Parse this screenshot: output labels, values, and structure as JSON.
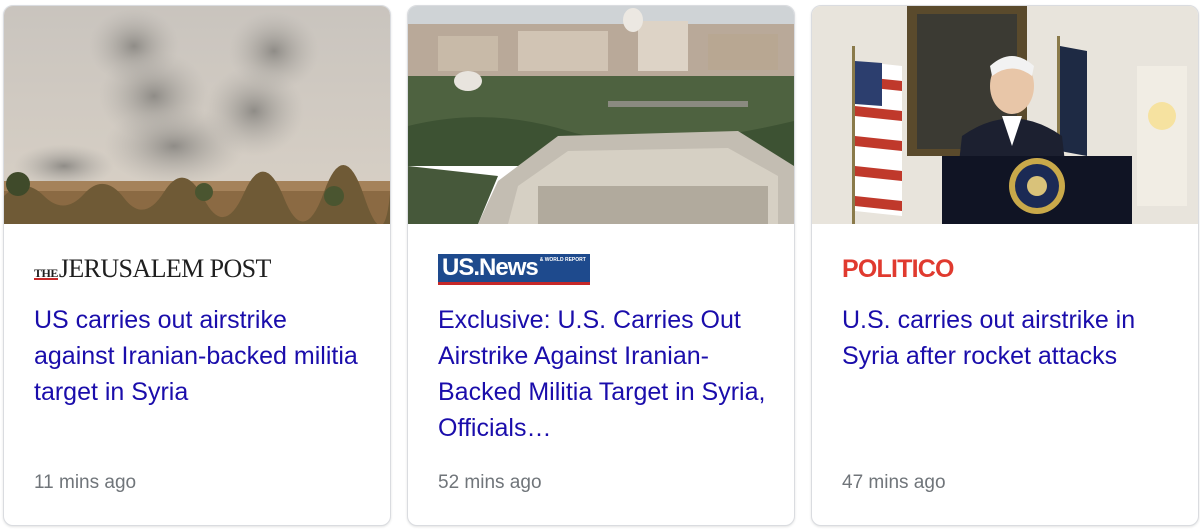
{
  "cards": [
    {
      "source": "THE JERUSALEM POST",
      "source_prefix": "THE",
      "source_name": "JERUSALEM POST",
      "headline": "US carries out airstrike against Iranian-backed militia target in Syria",
      "time": "11 mins ago",
      "image": "smoke-plumes-over-field"
    },
    {
      "source": "US News",
      "source_name": "US.News",
      "source_tag": "& WORLD REPORT",
      "headline": "Exclusive: U.S. Carries Out Airstrike Against Iranian-Backed Militia Target in Syria, Officials…",
      "time": "52 mins ago",
      "image": "pentagon-aerial-view"
    },
    {
      "source": "POLITICO",
      "source_name": "POLITICO",
      "headline": "U.S. carries out airstrike in Syria after rocket attacks",
      "time": "47 mins ago",
      "image": "president-at-podium"
    }
  ],
  "colors": {
    "headline": "#1a0dab",
    "time": "#70757a",
    "border": "#dadce0",
    "politico": "#e03a2f",
    "usnews": "#1e4a8d"
  }
}
